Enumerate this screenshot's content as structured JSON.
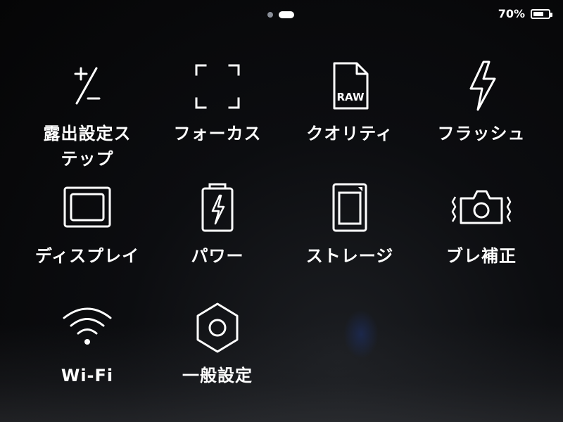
{
  "status": {
    "battery_percent": "70%",
    "battery_level": 0.7
  },
  "pager": {
    "pages": 2,
    "current_page": 2
  },
  "menu": {
    "items": [
      {
        "label": "露出設定ステップ",
        "label_lines": [
          "露出設定ス",
          "テップ"
        ],
        "icon": "exposure-step-icon"
      },
      {
        "label": "フォーカス",
        "icon": "focus-frame-icon"
      },
      {
        "label": "クオリティ",
        "icon": "raw-file-icon",
        "icon_text": "RAW"
      },
      {
        "label": "フラッシュ",
        "icon": "lightning-icon"
      },
      {
        "label": "ディスプレイ",
        "icon": "display-icon"
      },
      {
        "label": "パワー",
        "icon": "battery-power-icon"
      },
      {
        "label": "ストレージ",
        "icon": "storage-card-icon"
      },
      {
        "label": "ブレ補正",
        "icon": "stabilization-camera-icon"
      },
      {
        "label": "Wi-Fi",
        "icon": "wifi-icon"
      },
      {
        "label": "一般設定",
        "icon": "hexagon-nut-icon"
      }
    ]
  }
}
